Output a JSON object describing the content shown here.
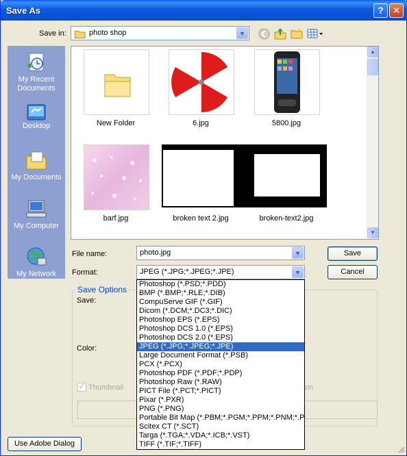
{
  "window": {
    "title": "Save As"
  },
  "toolbar": {
    "save_in_label": "Save in:",
    "save_in_value": "photo shop"
  },
  "places": [
    {
      "label": "My Recent Documents"
    },
    {
      "label": "Desktop"
    },
    {
      "label": "My Documents"
    },
    {
      "label": "My Computer"
    },
    {
      "label": "My Network"
    }
  ],
  "files": [
    {
      "name": "New Folder"
    },
    {
      "name": "6.jpg"
    },
    {
      "name": "5800.jpg"
    },
    {
      "name": "barf.jpg"
    },
    {
      "name": "broken text 2.jpg"
    },
    {
      "name": "broken-text2.jpg"
    }
  ],
  "form": {
    "file_name_label": "File name:",
    "file_name_value": "photo.jpg",
    "format_label": "Format:",
    "format_value": "JPEG (*.JPG;*.JPEG;*.JPE)",
    "save_button": "Save",
    "cancel_button": "Cancel"
  },
  "save_options": {
    "title": "Save Options",
    "save_label": "Save:",
    "color_label": "Color:",
    "thumbnail_label": "Thumbnail",
    "partial_label": "on"
  },
  "format_options": [
    "Photoshop (*.PSD;*.PDD)",
    "BMP (*.BMP;*.RLE;*.DIB)",
    "CompuServe GIF (*.GIF)",
    "Dicom (*.DCM;*.DC3;*.DIC)",
    "Photoshop EPS (*.EPS)",
    "Photoshop DCS 1.0 (*.EPS)",
    "Photoshop DCS 2.0 (*.EPS)",
    "JPEG (*.JPG;*.JPEG;*.JPE)",
    "Large Document Format (*.PSB)",
    "PCX (*.PCX)",
    "Photoshop PDF (*.PDF;*.PDP)",
    "Photoshop Raw (*.RAW)",
    "PICT File (*.PCT;*.PICT)",
    "Pixar (*.PXR)",
    "PNG (*.PNG)",
    "Portable Bit Map (*.PBM;*.PGM;*.PPM;*.PNM;*.PFM",
    "Scitex CT (*.SCT)",
    "Targa (*.TGA;*.VDA;*.ICB;*.VST)",
    "TIFF (*.TIF;*.TIFF)"
  ],
  "selected_format_index": 7,
  "footer": {
    "adobe_dialog_button": "Use Adobe Dialog"
  },
  "colors": {
    "title_bar": "#0b4fd4",
    "places_bar": "#8e9fd1",
    "selection": "#316ac5",
    "group_title": "#0046d5"
  }
}
